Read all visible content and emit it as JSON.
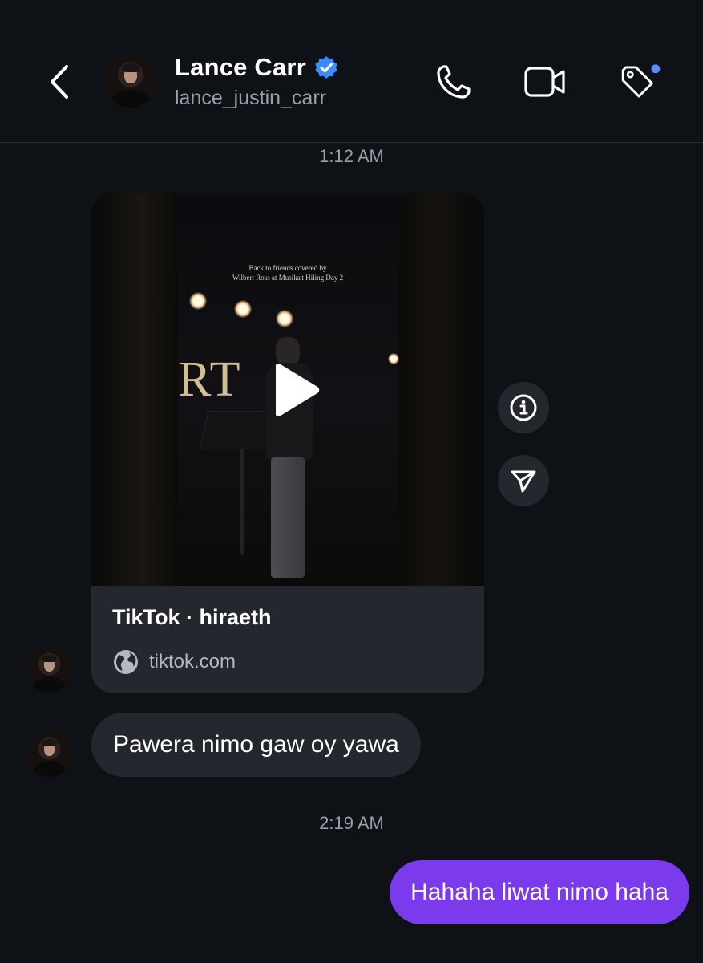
{
  "header": {
    "contact_name": "Lance Carr",
    "contact_handle": "lance_justin_carr",
    "verified": true,
    "accent_color": "#3d8bfd",
    "notification_dot_color": "#5b8cff",
    "icons": [
      "chevron-left-icon",
      "phone-icon",
      "video-camera-icon",
      "tag-icon"
    ]
  },
  "conversation": {
    "timestamps": [
      "1:12 AM",
      "2:19 AM"
    ],
    "shared_card": {
      "video_caption": "Back to friends covered by\nWilbert Ross at Musika't Hiling Day 2",
      "stage_text": "RT",
      "title": "TikTok · hiraeth",
      "site": "tiktok.com",
      "icons": [
        "play-icon",
        "globe-icon"
      ]
    },
    "side_actions": [
      "info-icon",
      "send-icon"
    ],
    "incoming_message": "Pawera nimo gaw oy yawa",
    "outgoing_message": "Hahaha liwat nimo haha",
    "colors": {
      "background": "#0e1116",
      "incoming_bubble": "#24272d",
      "outgoing_bubble": "#7c3aed"
    }
  }
}
